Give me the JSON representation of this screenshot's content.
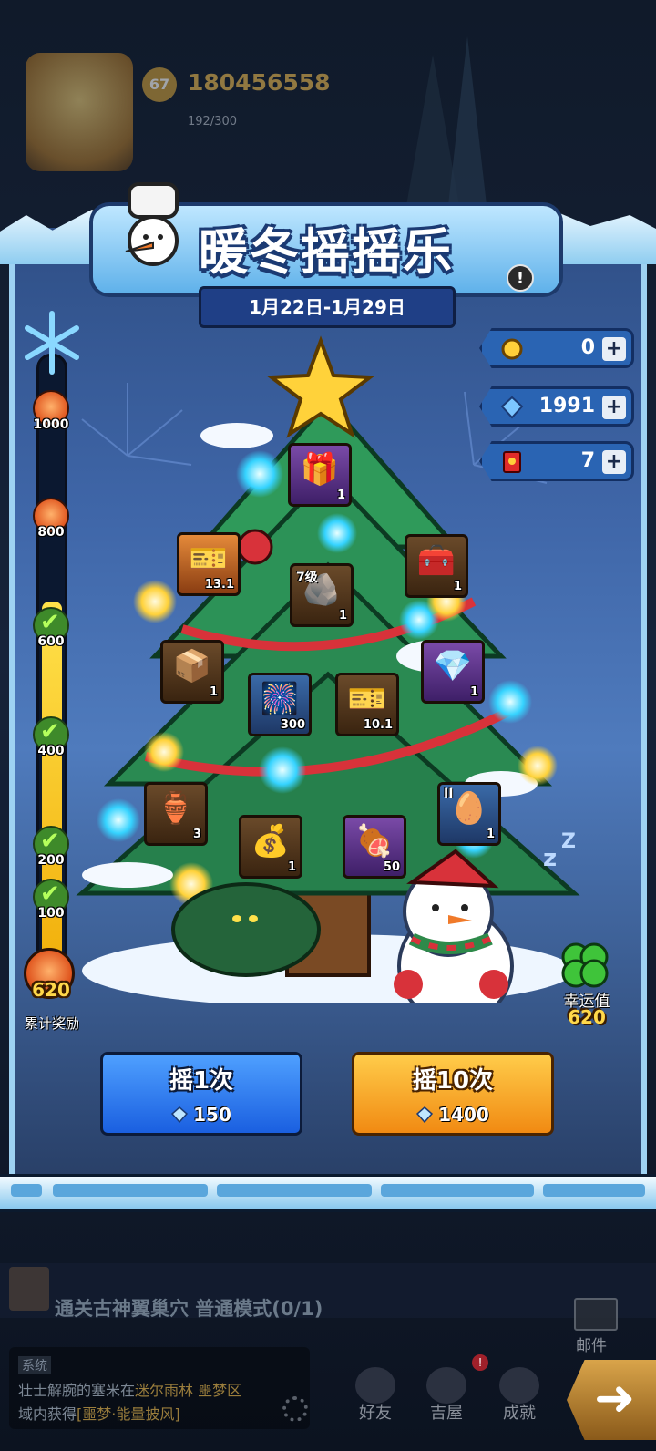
{
  "player": {
    "level": "67",
    "id": "180456558",
    "energy": "192/300"
  },
  "event": {
    "title": "暖冬摇摇乐",
    "dates": "1月22日-1月29日",
    "info_icon": "!"
  },
  "currencies": [
    {
      "icon": "medal-icon",
      "value": "0"
    },
    {
      "icon": "diamond-icon",
      "value": "1991"
    },
    {
      "icon": "red-envelope-icon",
      "value": "7"
    }
  ],
  "progress": {
    "milestones": [
      {
        "label": "1000",
        "state": "locked"
      },
      {
        "label": "800",
        "state": "locked"
      },
      {
        "label": "600",
        "state": "claimed"
      },
      {
        "label": "400",
        "state": "claimed"
      },
      {
        "label": "200",
        "state": "claimed"
      },
      {
        "label": "100",
        "state": "claimed"
      }
    ],
    "fill_fraction": 0.62,
    "accum_value": "620",
    "accum_label": "累计奖励"
  },
  "tree_items": [
    {
      "name": "snowflake-chest-item",
      "glyph": "🎁",
      "count": "1",
      "tag": "",
      "style": "purple"
    },
    {
      "name": "ticket-item",
      "glyph": "🎫",
      "count": "13.1",
      "tag": "",
      "style": "orange"
    },
    {
      "name": "treasure-chest-item",
      "glyph": "🧰",
      "count": "1",
      "tag": "",
      "style": ""
    },
    {
      "name": "level7-ore-item",
      "glyph": "🪨",
      "count": "1",
      "tag": "7级",
      "style": ""
    },
    {
      "name": "wooden-chest-item",
      "glyph": "📦",
      "count": "1",
      "tag": "",
      "style": ""
    },
    {
      "name": "firework-item",
      "glyph": "🎆",
      "count": "300",
      "tag": "",
      "style": "blue"
    },
    {
      "name": "ticket-item-2",
      "glyph": "🎫",
      "count": "10.1",
      "tag": "",
      "style": ""
    },
    {
      "name": "gem-bag-item",
      "glyph": "💎",
      "count": "1",
      "tag": "",
      "style": "purple"
    },
    {
      "name": "golden-urn-item",
      "glyph": "🏺",
      "count": "3",
      "tag": "",
      "style": ""
    },
    {
      "name": "gold-sack-item",
      "glyph": "💰",
      "count": "1",
      "tag": "",
      "style": ""
    },
    {
      "name": "meat-item",
      "glyph": "🍖",
      "count": "50",
      "tag": "",
      "style": "purple"
    },
    {
      "name": "pet-egg-item",
      "glyph": "🥚",
      "count": "1",
      "tag": "II",
      "style": "blue"
    }
  ],
  "luck": {
    "label": "幸运值",
    "value": "620"
  },
  "buttons": {
    "shake_once": {
      "label": "摇1次",
      "cost": "150"
    },
    "shake_ten": {
      "label": "摇10次",
      "cost": "1400"
    }
  },
  "quest": {
    "text": "通关古神翼巢穴 普通模式(0/1)"
  },
  "mail": {
    "label": "邮件"
  },
  "chat": {
    "channel": "系统",
    "line1_a": "壮士解腕的塞米在",
    "line1_b": "迷尔雨林 噩梦区",
    "line2_a": "域内获得",
    "line2_b": "[噩梦·能量披风]"
  },
  "nav": [
    {
      "label": "好友"
    },
    {
      "label": "吉屋"
    },
    {
      "label": "成就"
    }
  ],
  "colors": {
    "panel": "#3f66a8",
    "shake_once": "#1a5fe0",
    "shake_ten": "#f18a12",
    "gold_text": "#ffd84a"
  }
}
